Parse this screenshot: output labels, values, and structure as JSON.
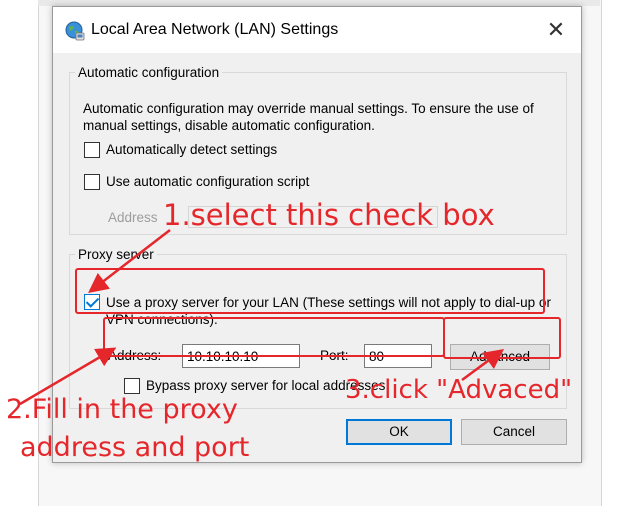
{
  "dialog": {
    "title": "Local Area Network (LAN) Settings",
    "close_symbol": "✕",
    "title_icon": "globe-network-icon"
  },
  "auto_config": {
    "legend": "Automatic configuration",
    "description": "Automatic configuration may override manual settings.  To ensure the use of manual settings, disable automatic configuration.",
    "detect_settings_label": "Automatically detect settings",
    "detect_settings_checked": false,
    "script_label": "Use automatic configuration script",
    "script_checked": false,
    "address_label": "Address",
    "address_value": ""
  },
  "proxy": {
    "legend": "Proxy server",
    "use_proxy_label": "Use a proxy server for your LAN (These settings will not apply to dial-up or VPN connections).",
    "use_proxy_checked": true,
    "address_label": "Address:",
    "address_value": "10.10.10.10",
    "port_label": "Port:",
    "port_value": "80",
    "advanced_label": "Advanced",
    "bypass_label": "Bypass proxy server for local addresses",
    "bypass_checked": false
  },
  "buttons": {
    "ok": "OK",
    "cancel": "Cancel"
  },
  "annotations": {
    "step1": "1.select this check box",
    "step2_line1": "2.Fill in the proxy",
    "step2_line2": "address and port",
    "step3": "3.click \"Advaced\"",
    "color": "#e5262b"
  }
}
